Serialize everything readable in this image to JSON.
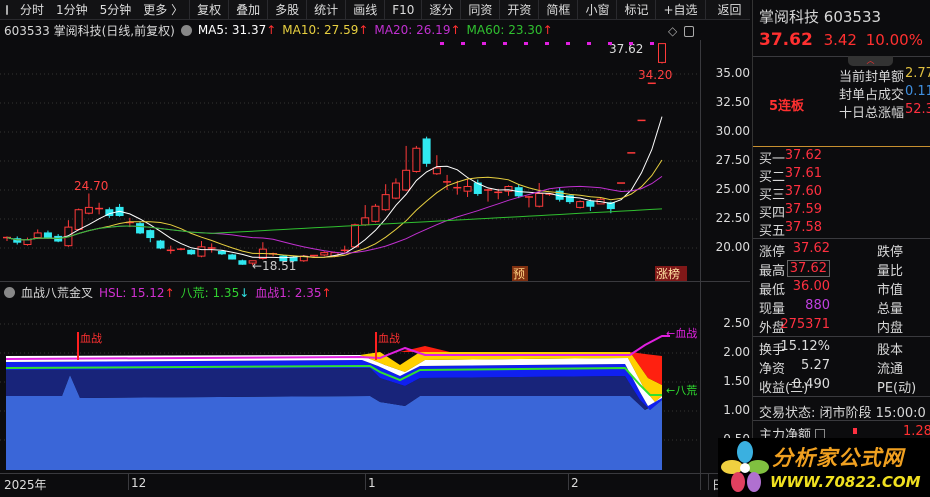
{
  "toolbar": {
    "items": [
      "分时",
      "1分钟",
      "5分钟",
      "更多 〉"
    ],
    "right": [
      "复权",
      "叠加",
      "多股",
      "统计",
      "画线",
      "F10",
      "逐分",
      "同资",
      "开资",
      "简框",
      "小窗",
      "标记",
      "+自选",
      "返回"
    ]
  },
  "info": {
    "title": "603533 掌阅科技(日线,前复权)",
    "ma5": "MA5: 31.37",
    "ma10": "MA10: 27.59",
    "ma20": "MA20: 26.19",
    "ma60": "MA60: 23.30",
    "arrow_up": "↑"
  },
  "colors": {
    "ma5": "#ffffff",
    "ma10": "#e8d040",
    "ma20": "#c030d0",
    "ma60": "#30c030",
    "up": "#ff3030",
    "down": "#30e0e0"
  },
  "chart_data": {
    "type": "candlestick",
    "price_axis": [
      "35.00",
      "32.50",
      "30.00",
      "27.50",
      "25.00",
      "22.50",
      "20.00"
    ],
    "ylim": [
      18,
      38
    ],
    "candles": [
      [
        20.8,
        20.9,
        20.6,
        21.0
      ],
      [
        20.8,
        20.5,
        20.3,
        21.0
      ],
      [
        20.3,
        20.7,
        20.2,
        20.9
      ],
      [
        20.9,
        21.3,
        20.8,
        21.6
      ],
      [
        21.3,
        20.9,
        20.8,
        21.5
      ],
      [
        21.0,
        20.6,
        20.5,
        21.2
      ],
      [
        20.2,
        21.8,
        20.1,
        22.4
      ],
      [
        21.6,
        23.3,
        21.5,
        23.4
      ],
      [
        23.0,
        23.5,
        22.9,
        24.7
      ],
      [
        23.4,
        23.4,
        22.9,
        23.9
      ],
      [
        23.3,
        22.8,
        22.6,
        23.5
      ],
      [
        23.5,
        22.8,
        22.7,
        23.8
      ],
      [
        22.2,
        22.2,
        21.8,
        22.6
      ],
      [
        22.1,
        21.3,
        21.2,
        22.3
      ],
      [
        21.5,
        20.9,
        20.5,
        21.6
      ],
      [
        20.6,
        20.0,
        19.9,
        20.7
      ],
      [
        19.8,
        19.8,
        19.5,
        20.2
      ],
      [
        19.9,
        19.9,
        19.8,
        20.0
      ],
      [
        19.8,
        19.5,
        19.4,
        19.9
      ],
      [
        19.3,
        20.1,
        19.2,
        20.6
      ],
      [
        20.0,
        20.0,
        19.6,
        20.4
      ],
      [
        19.7,
        19.5,
        19.4,
        19.8
      ],
      [
        19.4,
        19.05,
        19.0,
        19.5
      ],
      [
        18.9,
        18.6,
        18.55,
        19.0
      ],
      [
        18.7,
        18.9,
        18.51,
        18.9
      ],
      [
        19.1,
        19.9,
        19.0,
        20.5
      ],
      [
        19.4,
        19.5,
        19.3,
        19.6
      ],
      [
        19.3,
        18.9,
        18.8,
        19.4
      ],
      [
        19.2,
        18.9,
        18.8,
        19.3
      ],
      [
        18.9,
        19.3,
        18.8,
        19.4
      ],
      [
        19.3,
        19.35,
        19.2,
        19.4
      ],
      [
        19.4,
        19.6,
        19.3,
        19.7
      ],
      [
        19.3,
        19.6,
        19.2,
        19.7
      ],
      [
        19.8,
        19.8,
        19.6,
        20.2
      ],
      [
        20.1,
        22.0,
        20.0,
        22.1
      ],
      [
        22.0,
        22.6,
        21.9,
        23.7
      ],
      [
        22.3,
        23.6,
        22.2,
        23.8
      ],
      [
        23.3,
        24.6,
        23.2,
        25.5
      ],
      [
        24.3,
        25.6,
        24.2,
        26.0
      ],
      [
        25.0,
        26.7,
        24.9,
        28.8
      ],
      [
        26.6,
        28.6,
        26.5,
        28.8
      ],
      [
        29.4,
        27.3,
        27.0,
        29.6
      ],
      [
        26.4,
        26.9,
        26.3,
        28.0
      ],
      [
        25.7,
        25.7,
        25.0,
        26.3
      ],
      [
        25.2,
        25.2,
        24.6,
        25.8
      ],
      [
        24.9,
        25.3,
        24.4,
        25.9
      ],
      [
        25.6,
        24.7,
        24.5,
        25.9
      ],
      [
        24.9,
        25.0,
        24.0,
        25.1
      ],
      [
        24.7,
        24.8,
        24.2,
        25.1
      ],
      [
        24.9,
        25.3,
        24.5,
        25.4
      ],
      [
        25.2,
        24.5,
        24.3,
        25.5
      ],
      [
        24.3,
        24.4,
        23.5,
        24.5
      ],
      [
        23.6,
        24.7,
        23.5,
        25.6
      ],
      [
        24.6,
        24.65,
        24.5,
        24.7
      ],
      [
        24.9,
        24.2,
        24.0,
        25.2
      ],
      [
        24.5,
        24.0,
        23.8,
        24.6
      ],
      [
        23.5,
        24.0,
        23.4,
        24.1
      ],
      [
        24.0,
        23.6,
        23.2,
        24.2
      ],
      [
        23.8,
        24.2,
        23.8,
        24.3
      ],
      [
        23.9,
        23.4,
        23.0,
        24.0
      ],
      [
        25.6,
        25.6,
        25.6,
        25.6
      ],
      [
        28.2,
        28.2,
        28.2,
        28.2
      ],
      [
        31.0,
        31.0,
        31.0,
        31.0
      ],
      [
        34.2,
        34.2,
        34.2,
        34.2
      ],
      [
        36.0,
        37.62,
        35.9,
        37.62
      ]
    ],
    "labels": {
      "high": "24.70",
      "low": "←18.51",
      "last_high": "37.62",
      "prev_close": "34.20",
      "yu": "预",
      "zhangbang": "涨榜"
    }
  },
  "sub": {
    "title": "血战八荒金叉",
    "hsl": "HSL: 15.12",
    "bahuang": "八荒: 1.35",
    "xuezhan1": "血战1: 2.35",
    "arrow_up": "↑",
    "arrow_down": "↓",
    "axis": [
      "2.50",
      "2.00",
      "1.50",
      "1.00",
      "0.50"
    ],
    "marker": "血战",
    "tag_xuezhan": "←血战",
    "tag_bahuang": "←八荒"
  },
  "xaxis": [
    "2025年",
    "12",
    "1",
    "2",
    "日"
  ],
  "panel": {
    "name": "掌阅科技",
    "code": "603533",
    "price": "37.62",
    "change": "3.42",
    "pct": "10.00%",
    "streak": "5连板",
    "seal": [
      {
        "k": "当前封单额",
        "v": "2.77"
      },
      {
        "k": "封单占成交",
        "v": "0.11"
      },
      {
        "k": "十日总涨幅",
        "v": "52.3"
      }
    ],
    "bids": [
      {
        "k": "买一",
        "v": "37.62"
      },
      {
        "k": "买二",
        "v": "37.61"
      },
      {
        "k": "买三",
        "v": "37.60"
      },
      {
        "k": "买四",
        "v": "37.59"
      },
      {
        "k": "买五",
        "v": "37.58"
      }
    ],
    "stats": [
      {
        "k": "涨停",
        "v": "37.62",
        "k2": "跌停"
      },
      {
        "k": "最高",
        "v": "37.62",
        "k2": "量比"
      },
      {
        "k": "最低",
        "v": "36.00",
        "k2": "市值"
      },
      {
        "k": "现量",
        "v": "880",
        "k2": "总量"
      },
      {
        "k": "外盘",
        "v": "275371",
        "k2": "内盘"
      }
    ],
    "stats2": [
      {
        "k": "换手",
        "v": "15.12%",
        "k2": "股本"
      },
      {
        "k": "净资",
        "v": "5.27",
        "k2": "流通"
      },
      {
        "k": "收益(三)",
        "v": "-0.490",
        "k2": "PE(动)"
      }
    ],
    "status": "交易状态: 闭市阶段 15:00:0",
    "main_net": "主力净额",
    "main_net_v": "1.28"
  },
  "logo": {
    "cn": "分析家公式网",
    "url": "WWW.70822.COM"
  }
}
